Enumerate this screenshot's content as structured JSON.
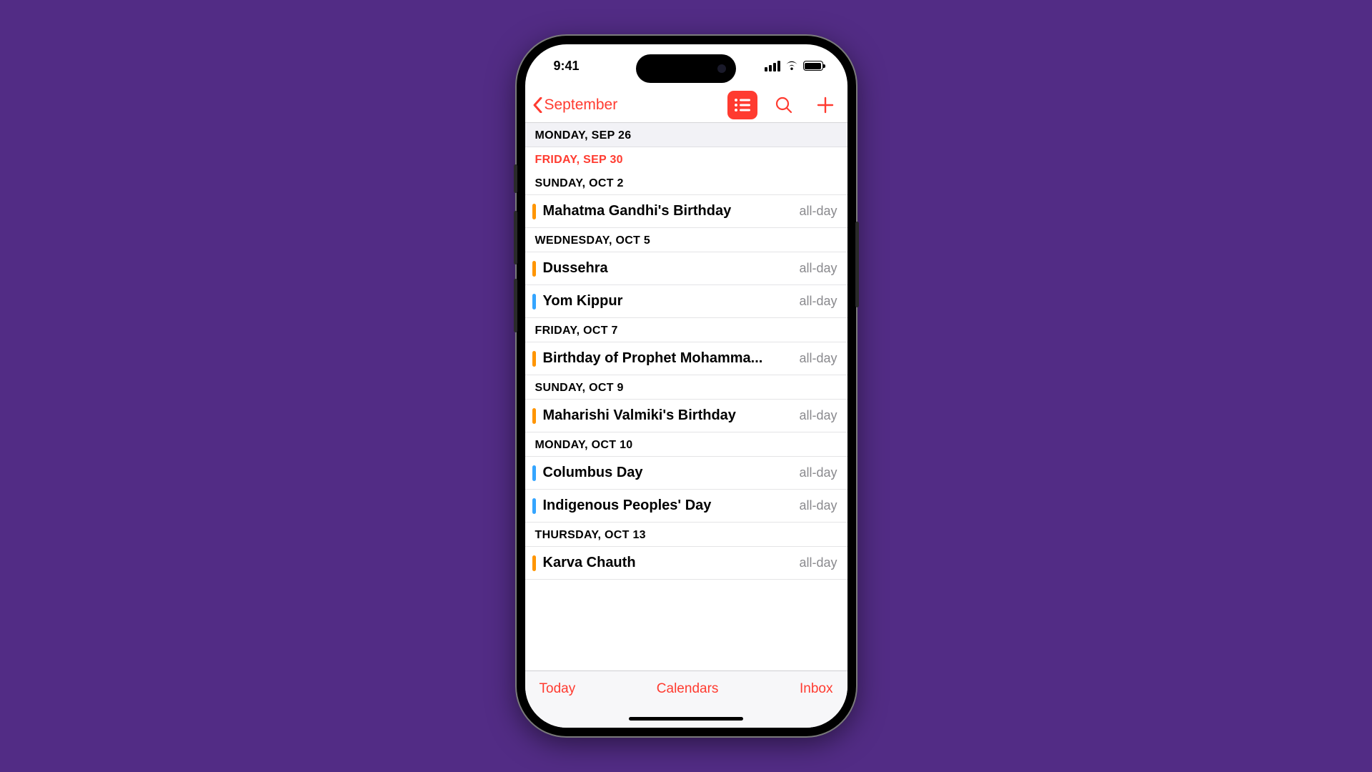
{
  "status": {
    "time": "9:41"
  },
  "nav": {
    "back_label": "September"
  },
  "colors": {
    "accent": "#ff3b30",
    "orange": "#ff9500",
    "blue": "#34a5ff"
  },
  "tabbar": {
    "today": "Today",
    "calendars": "Calendars",
    "inbox": "Inbox"
  },
  "sections": [
    {
      "header": "MONDAY, SEP 26",
      "grey": true,
      "events": []
    },
    {
      "header": "FRIDAY, SEP 30",
      "today": true,
      "events": []
    },
    {
      "header": "SUNDAY, OCT 2",
      "events": [
        {
          "title": "Mahatma Gandhi's Birthday",
          "time": "all-day",
          "color": "orange"
        }
      ]
    },
    {
      "header": "WEDNESDAY, OCT 5",
      "events": [
        {
          "title": "Dussehra",
          "time": "all-day",
          "color": "orange"
        },
        {
          "title": "Yom Kippur",
          "time": "all-day",
          "color": "blue"
        }
      ]
    },
    {
      "header": "FRIDAY, OCT 7",
      "events": [
        {
          "title": "Birthday of Prophet Mohamma...",
          "time": "all-day",
          "color": "orange"
        }
      ]
    },
    {
      "header": "SUNDAY, OCT 9",
      "events": [
        {
          "title": "Maharishi Valmiki's Birthday",
          "time": "all-day",
          "color": "orange"
        }
      ]
    },
    {
      "header": "MONDAY, OCT 10",
      "events": [
        {
          "title": "Columbus Day",
          "time": "all-day",
          "color": "blue"
        },
        {
          "title": "Indigenous Peoples' Day",
          "time": "all-day",
          "color": "blue"
        }
      ]
    },
    {
      "header": "THURSDAY, OCT 13",
      "events": [
        {
          "title": "Karva Chauth",
          "time": "all-day",
          "color": "orange"
        }
      ]
    }
  ]
}
